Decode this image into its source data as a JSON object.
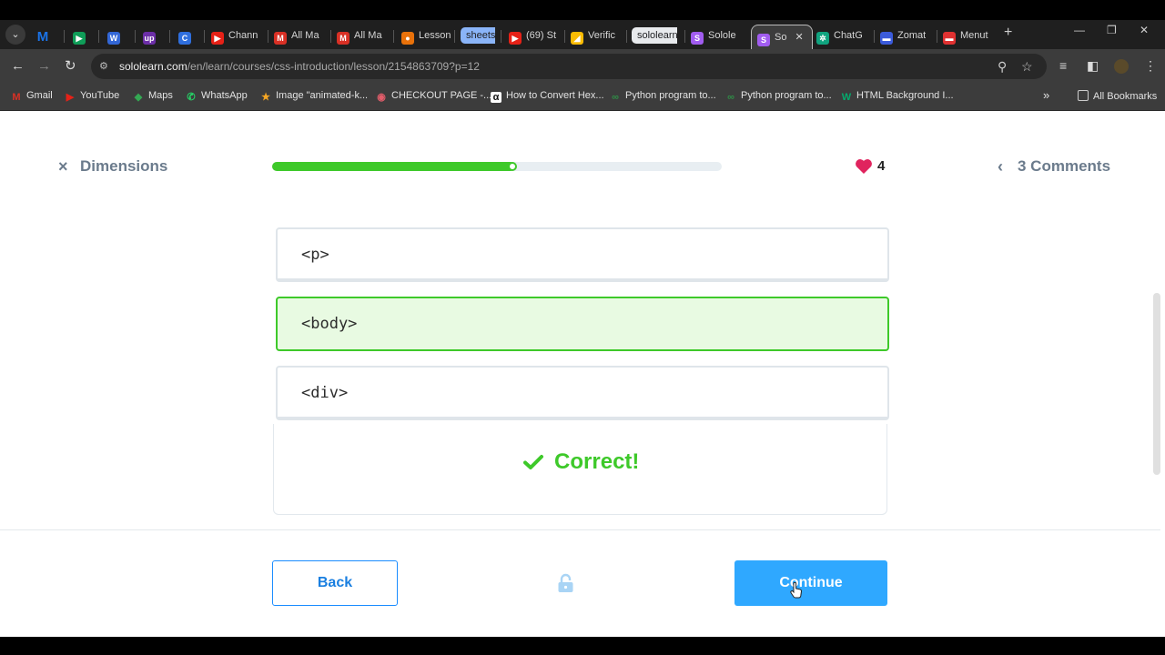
{
  "browser": {
    "tabs": [
      {
        "label": "",
        "icon": "gmail-m-icon",
        "fav": "M",
        "color": "#1a73e8"
      },
      {
        "label": "",
        "icon": "play-icon",
        "fav": "▶",
        "color": "#0f9d58"
      },
      {
        "label": "",
        "icon": "app-icon",
        "fav": "W",
        "color": "#3367d6"
      },
      {
        "label": "",
        "icon": "upwork-icon",
        "fav": "up",
        "color": "#6c2ea8"
      },
      {
        "label": "",
        "icon": "circle-c-icon",
        "fav": "C",
        "color": "#2f6fde"
      },
      {
        "label": "Chann",
        "icon": "youtube-icon",
        "fav": "▶",
        "color": "#e62117"
      },
      {
        "label": "All Ma",
        "icon": "gmail-icon",
        "fav": "M",
        "color": "#d93025"
      },
      {
        "label": "All Ma",
        "icon": "gmail-icon",
        "fav": "M",
        "color": "#d93025"
      },
      {
        "label": "Lesson",
        "icon": "lesson-icon",
        "fav": "●",
        "color": "#e8710a"
      },
      {
        "label": "sheets",
        "icon": "sheets-pill",
        "fav": "",
        "color": "#8ab4f8"
      },
      {
        "label": "(69) St",
        "icon": "youtube-icon",
        "fav": "▶",
        "color": "#e62117"
      },
      {
        "label": "Verific",
        "icon": "ads-icon",
        "fav": "◢",
        "color": "#fbbc04"
      },
      {
        "label": "sololearn",
        "icon": "sololearn-pill",
        "fav": "",
        "color": "#e8eaed"
      },
      {
        "label": "Solole",
        "icon": "sololearn-icon",
        "fav": "S",
        "color": "#a15cf0"
      },
      {
        "label": "So",
        "icon": "sololearn-icon",
        "fav": "S",
        "color": "#a15cf0",
        "active": true
      },
      {
        "label": "ChatG",
        "icon": "chatgpt-icon",
        "fav": "✲",
        "color": "#10a37f"
      },
      {
        "label": "Zomat",
        "icon": "zomato-icon",
        "fav": "▬",
        "color": "#3b5bdb"
      },
      {
        "label": "Menut",
        "icon": "menu-icon",
        "fav": "▬",
        "color": "#e03131"
      }
    ],
    "url_host": "sololearn.com",
    "url_path": "/en/learn/courses/css-introduction/lesson/2154863709?p=12",
    "bookmarks": [
      {
        "label": "Gmail",
        "icon": "gmail-icon",
        "fav": "M",
        "color": "#d93025"
      },
      {
        "label": "YouTube",
        "icon": "youtube-icon",
        "fav": "▶",
        "color": "#e62117"
      },
      {
        "label": "Maps",
        "icon": "maps-icon",
        "fav": "◆",
        "color": "#34a853"
      },
      {
        "label": "WhatsApp",
        "icon": "whatsapp-icon",
        "fav": "✆",
        "color": "#25d366"
      },
      {
        "label": "Image \"animated-k...",
        "icon": "star-icon",
        "fav": "★",
        "color": "#f5a623"
      },
      {
        "label": "CHECKOUT PAGE -...",
        "icon": "lips-icon",
        "fav": "◉",
        "color": "#e35d6a"
      },
      {
        "label": "How to Convert Hex...",
        "icon": "alpha-icon",
        "fav": "α",
        "color": "#111111"
      },
      {
        "label": "Python program to...",
        "icon": "gfg-icon",
        "fav": "∞",
        "color": "#2f8d46"
      },
      {
        "label": "Python program to...",
        "icon": "gfg-icon",
        "fav": "∞",
        "color": "#2f8d46"
      },
      {
        "label": "HTML Background I...",
        "icon": "w-icon",
        "fav": "W",
        "color": "#04aa6d"
      }
    ],
    "all_bookmarks": "All Bookmarks"
  },
  "lesson": {
    "close_label": "×",
    "title": "Dimensions",
    "progress": 0.54,
    "hearts": "4",
    "comments_label": "3 Comments",
    "options": [
      {
        "code": "<p>",
        "state": "default"
      },
      {
        "code": "<body>",
        "state": "correct"
      },
      {
        "code": "<div>",
        "state": "default"
      }
    ],
    "feedback": "Correct!",
    "back_label": "Back",
    "continue_label": "Continue",
    "colors": {
      "accent": "#2fa8ff",
      "success": "#3ec92a",
      "heart": "#e0245e"
    }
  }
}
